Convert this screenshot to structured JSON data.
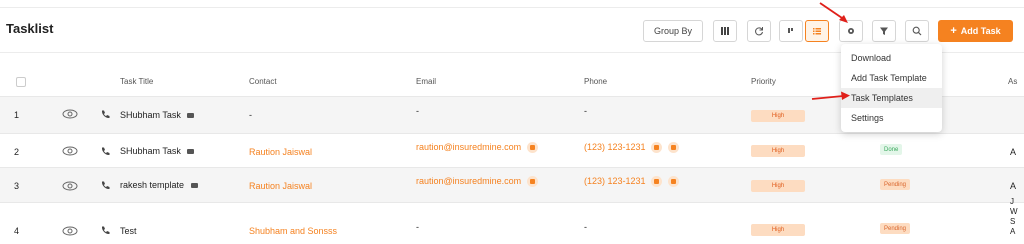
{
  "header": {
    "title": "Tasklist",
    "group_by_label": "Group By",
    "add_task_label": "Add Task"
  },
  "table": {
    "columns": [
      "Task Title",
      "Contact",
      "Email",
      "Phone",
      "Priority",
      "As"
    ],
    "rows": [
      {
        "index": "1",
        "title": "SHubham Task",
        "contact": "-",
        "email": "-",
        "phone": "-",
        "priority": "High",
        "status": "",
        "extra": ""
      },
      {
        "index": "2",
        "title": "SHubham Task",
        "contact": "Raution Jaiswal",
        "email": "raution@insuredmine.com",
        "phone": "(123) 123-1231",
        "priority": "High",
        "status": "Done",
        "extra": "A"
      },
      {
        "index": "3",
        "title": "rakesh template",
        "contact": "Raution Jaiswal",
        "email": "raution@insuredmine.com",
        "phone": "(123) 123-1231",
        "priority": "High",
        "status": "Pending",
        "extra": "A"
      },
      {
        "index": "4",
        "title": "Test",
        "contact": "Shubham and Sonsss",
        "email": "-",
        "phone": "-",
        "priority": "High",
        "status": "Pending",
        "extra": "J\nW\nS\nA"
      }
    ]
  },
  "settings_menu": {
    "items": [
      "Download",
      "Add Task Template",
      "Task Templates",
      "Settings"
    ],
    "highlighted_index": 2
  },
  "colors": {
    "accent": "#f58220",
    "annotation_arrow": "#e0201a"
  }
}
